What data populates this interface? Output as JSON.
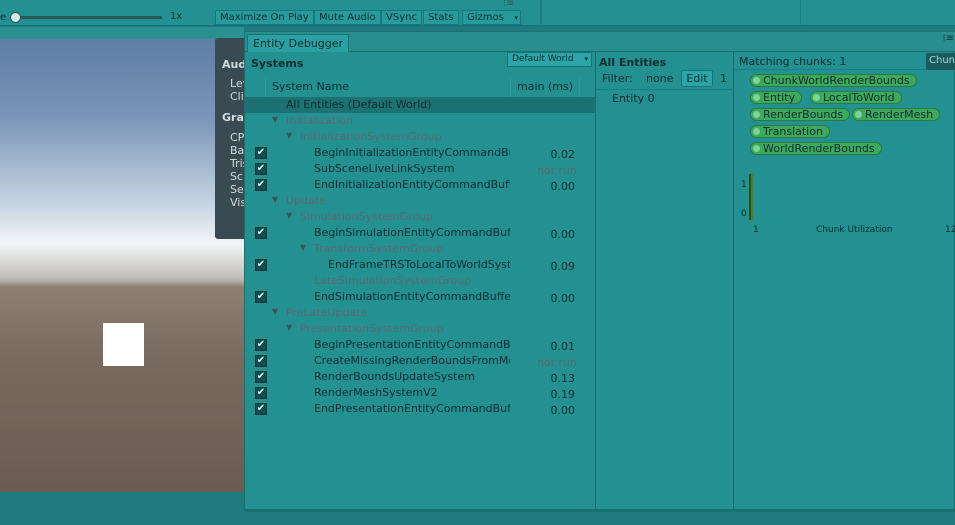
{
  "toolbar": {
    "scale_label": "e",
    "scale_value": "1x",
    "buttons": [
      "Maximize On Play",
      "Mute Audio",
      "VSync",
      "Stats",
      "Gizmos"
    ],
    "dots": "⁝≡"
  },
  "stats_overlay": {
    "audio_heading": "Audio:",
    "audio_lines": [
      "Level",
      "Clipping"
    ],
    "graphics_heading": "Graphics:",
    "graphics_lines": [
      "CPU",
      "Batches",
      "Tris",
      "Screen",
      "SetPass",
      "Visible"
    ]
  },
  "debugger": {
    "tab_title": "Entity Debugger",
    "menu_icon": "⁝≡",
    "systems": {
      "title": "Systems",
      "world_dropdown": "Default World",
      "col_name": "System Name",
      "col_time": "main (ms)",
      "rows": [
        {
          "indent": 0,
          "name": "All Entities (Default World)",
          "checkbox": false,
          "arrow": false,
          "group": false,
          "time": "",
          "selected": true
        },
        {
          "indent": 0,
          "name": "Initialization",
          "checkbox": false,
          "arrow": true,
          "group": true,
          "time": ""
        },
        {
          "indent": 1,
          "name": "InitializationSystemGroup",
          "checkbox": false,
          "arrow": true,
          "group": true,
          "time": ""
        },
        {
          "indent": 2,
          "name": "BeginInitializationEntityCommandBufferSystem",
          "checkbox": true,
          "arrow": false,
          "group": false,
          "time": "0.02"
        },
        {
          "indent": 2,
          "name": "SubSceneLiveLinkSystem",
          "checkbox": true,
          "arrow": false,
          "group": false,
          "time": "not run"
        },
        {
          "indent": 2,
          "name": "EndInitializationEntityCommandBufferSystem",
          "checkbox": true,
          "arrow": false,
          "group": false,
          "time": "0.00"
        },
        {
          "indent": 0,
          "name": "Update",
          "checkbox": false,
          "arrow": true,
          "group": true,
          "time": ""
        },
        {
          "indent": 1,
          "name": "SimulationSystemGroup",
          "checkbox": false,
          "arrow": true,
          "group": true,
          "time": ""
        },
        {
          "indent": 2,
          "name": "BeginSimulationEntityCommandBufferSystem",
          "checkbox": true,
          "arrow": false,
          "group": false,
          "time": "0.00"
        },
        {
          "indent": 2,
          "name": "TransformSystemGroup",
          "checkbox": false,
          "arrow": true,
          "group": true,
          "time": ""
        },
        {
          "indent": 3,
          "name": "EndFrameTRSToLocalToWorldSystem",
          "checkbox": true,
          "arrow": false,
          "group": false,
          "time": "0.09"
        },
        {
          "indent": 2,
          "name": "LateSimulationSystemGroup",
          "checkbox": false,
          "arrow": false,
          "group": true,
          "time": ""
        },
        {
          "indent": 2,
          "name": "EndSimulationEntityCommandBufferSystem",
          "checkbox": true,
          "arrow": false,
          "group": false,
          "time": "0.00"
        },
        {
          "indent": 0,
          "name": "PreLateUpdate",
          "checkbox": false,
          "arrow": true,
          "group": true,
          "time": ""
        },
        {
          "indent": 1,
          "name": "PresentationSystemGroup",
          "checkbox": false,
          "arrow": true,
          "group": true,
          "time": ""
        },
        {
          "indent": 2,
          "name": "BeginPresentationEntityCommandBufferSystem",
          "checkbox": true,
          "arrow": false,
          "group": false,
          "time": "0.01"
        },
        {
          "indent": 2,
          "name": "CreateMissingRenderBoundsFromMeshRenderer",
          "checkbox": true,
          "arrow": false,
          "group": false,
          "time": "not run"
        },
        {
          "indent": 2,
          "name": "RenderBoundsUpdateSystem",
          "checkbox": true,
          "arrow": false,
          "group": false,
          "time": "0.13"
        },
        {
          "indent": 2,
          "name": "RenderMeshSystemV2",
          "checkbox": true,
          "arrow": false,
          "group": false,
          "time": "0.19"
        },
        {
          "indent": 2,
          "name": "EndPresentationEntityCommandBufferSystem",
          "checkbox": true,
          "arrow": false,
          "group": false,
          "time": "0.00"
        }
      ]
    },
    "entities": {
      "title": "All Entities",
      "filter_label": "Filter:",
      "filter_value": "none",
      "edit_label": "Edit",
      "count": "1",
      "list": [
        "Entity 0"
      ]
    },
    "chunks": {
      "matching_label": "Matching chunks: 1",
      "chunk_tab": "Chunk",
      "components": [
        "ChunkWorldRenderBounds",
        "Entity",
        "LocalToWorld",
        "RenderBounds",
        "RenderMesh",
        "Translation",
        "WorldRenderBounds"
      ],
      "chart_data": {
        "type": "bar",
        "xlabel": "Chunk Utilization",
        "x_ticks": [
          "1",
          "128"
        ],
        "y_ticks": [
          "1",
          "0"
        ],
        "categories": [
          "1"
        ],
        "values": [
          1
        ],
        "ylim": [
          0,
          1
        ]
      }
    }
  }
}
